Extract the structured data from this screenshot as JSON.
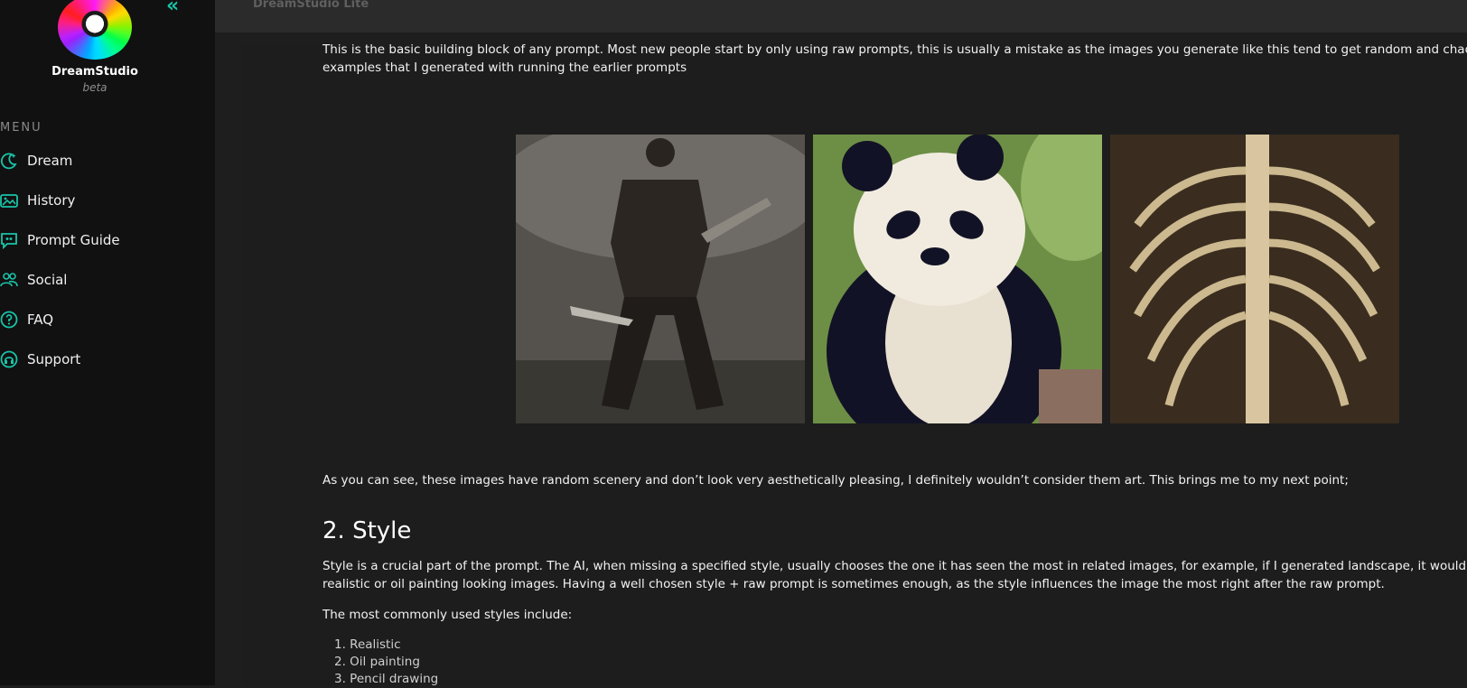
{
  "app": {
    "brand": "DreamStudio",
    "brand_sub": "beta",
    "top_title": "DreamStudio Lite",
    "collapse_icon": "double-chevron-left-icon",
    "accent_color": "#19c4a8"
  },
  "sidebar": {
    "menu_label": "MENU",
    "items": [
      {
        "label": "Dream",
        "icon": "sparkle-moon-icon"
      },
      {
        "label": "History",
        "icon": "image-gallery-icon"
      },
      {
        "label": "Prompt Guide",
        "icon": "quote-bubble-icon"
      },
      {
        "label": "Social",
        "icon": "people-icon"
      },
      {
        "label": "FAQ",
        "icon": "question-circle-icon"
      },
      {
        "label": "Support",
        "icon": "support-icon"
      }
    ]
  },
  "article": {
    "intro_line1": "This is the basic building block of any prompt. Most new people start by only using raw prompts, this is usually a mistake as the images you generate like this tend to get random and chao",
    "intro_line2": "examples that I generated with running the earlier prompts",
    "after_images": "As you can see, these images have random scenery and don’t look very aesthetically pleasing, I definitely wouldn’t consider them art. This brings me to my next point;",
    "section_heading": "2. Style",
    "style_line1": "Style is a crucial part of the prompt. The AI, when missing a specified style, usually chooses the one it has seen the most in related images, for example, if I generated landscape, it would p",
    "style_line2": "realistic or oil painting looking images. Having a well chosen style + raw prompt is sometimes enough, as the style influences the image the most right after the raw prompt.",
    "styles_intro": "The most commonly used styles include:",
    "styles_list": [
      "1. Realistic",
      "2. Oil painting",
      "3. Pencil drawing"
    ]
  }
}
